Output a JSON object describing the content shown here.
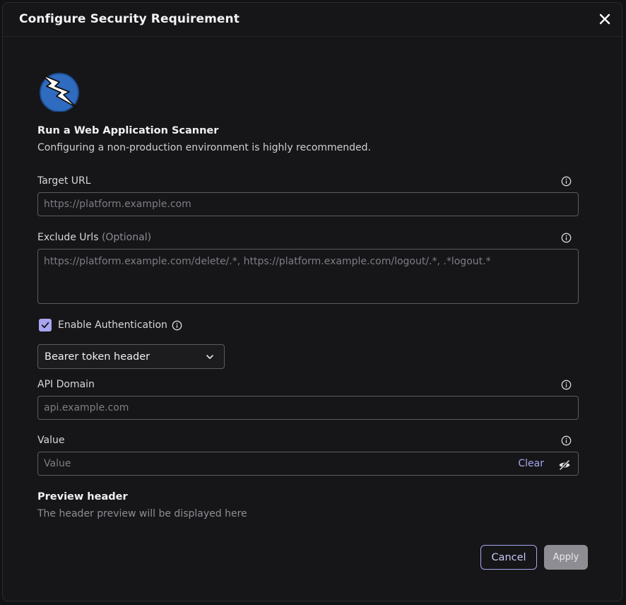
{
  "modal": {
    "title": "Configure Security Requirement"
  },
  "intro": {
    "title": "Run a Web Application Scanner",
    "subtitle": "Configuring a non-production environment is highly recommended."
  },
  "fields": {
    "target_url": {
      "label": "Target URL",
      "placeholder": "https://platform.example.com",
      "value": ""
    },
    "exclude_urls": {
      "label": "Exclude Urls",
      "optional": "(Optional)",
      "placeholder": "https://platform.example.com/delete/.*, https://platform.example.com/logout/.*, .*logout.*",
      "value": ""
    },
    "enable_auth": {
      "label": "Enable Authentication",
      "checked": true
    },
    "auth_type": {
      "selected": "Bearer token header"
    },
    "api_domain": {
      "label": "API Domain",
      "placeholder": "api.example.com",
      "value": ""
    },
    "value": {
      "label": "Value",
      "placeholder": "Value",
      "clear_label": "Clear"
    }
  },
  "preview": {
    "title": "Preview header",
    "placeholder": "The header preview will be displayed here"
  },
  "actions": {
    "cancel_label": "Cancel",
    "apply_label": "Apply"
  },
  "icons": {
    "close": "close-icon",
    "info": "info-icon",
    "chevron": "chevron-down-icon",
    "eye": "eye-off-icon",
    "logo": "lightning-logo-icon",
    "check": "check-icon"
  },
  "colors": {
    "accent": "#a8a6f0",
    "background": "#161618",
    "border": "#5a5a61",
    "logo_blue": "#2f6bbf"
  }
}
